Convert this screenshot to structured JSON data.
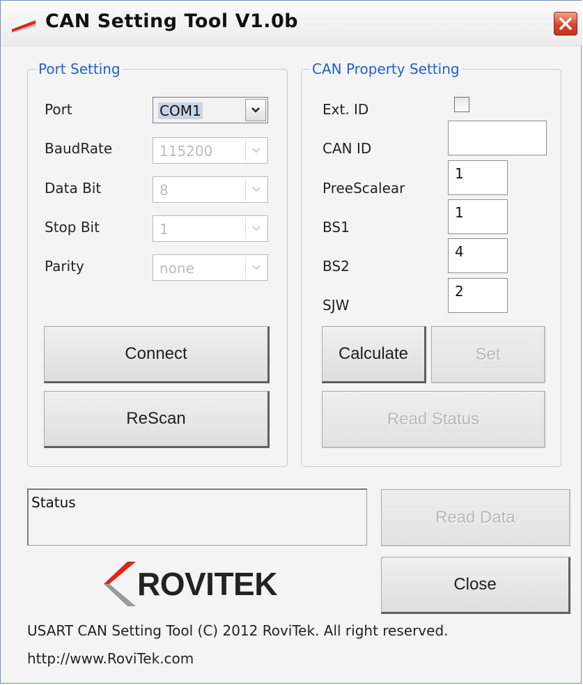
{
  "window": {
    "title": "CAN Setting Tool  V1.0b"
  },
  "port_setting": {
    "legend": "Port Setting",
    "port": {
      "label": "Port",
      "value": "COM1"
    },
    "baudrate": {
      "label": "BaudRate",
      "value": "115200"
    },
    "data_bit": {
      "label": "Data Bit",
      "value": "8"
    },
    "stop_bit": {
      "label": "Stop Bit",
      "value": "1"
    },
    "parity": {
      "label": "Parity",
      "value": "none"
    },
    "connect_label": "Connect",
    "rescan_label": "ReScan"
  },
  "can_setting": {
    "legend": "CAN Property Setting",
    "ext_id": {
      "label": "Ext. ID",
      "checked": false
    },
    "can_id": {
      "label": "CAN ID",
      "value": ""
    },
    "prescaler": {
      "label": "PreeScalear",
      "value": "1"
    },
    "bs1": {
      "label": "BS1",
      "value": "1"
    },
    "bs2": {
      "label": "BS2",
      "value": "4"
    },
    "sjw": {
      "label": "SJW",
      "value": "2"
    },
    "calculate_label": "Calculate",
    "set_label": "Set",
    "read_status_label": "Read Status"
  },
  "status": {
    "text": "Status"
  },
  "read_data_label": "Read Data",
  "close_label": "Close",
  "brand": {
    "name": "ROVITEK",
    "accent_color": "#e2231a",
    "shadow_color": "#9a9a9a"
  },
  "footer": {
    "copyright": "USART CAN Setting Tool (C) 2012 RoviTek. All right reserved.",
    "url": "http://www.RoviTek.com"
  },
  "icons": {
    "app": "rovitek-logo-icon",
    "close": "close-icon",
    "dropdown": "chevron-down-icon"
  }
}
